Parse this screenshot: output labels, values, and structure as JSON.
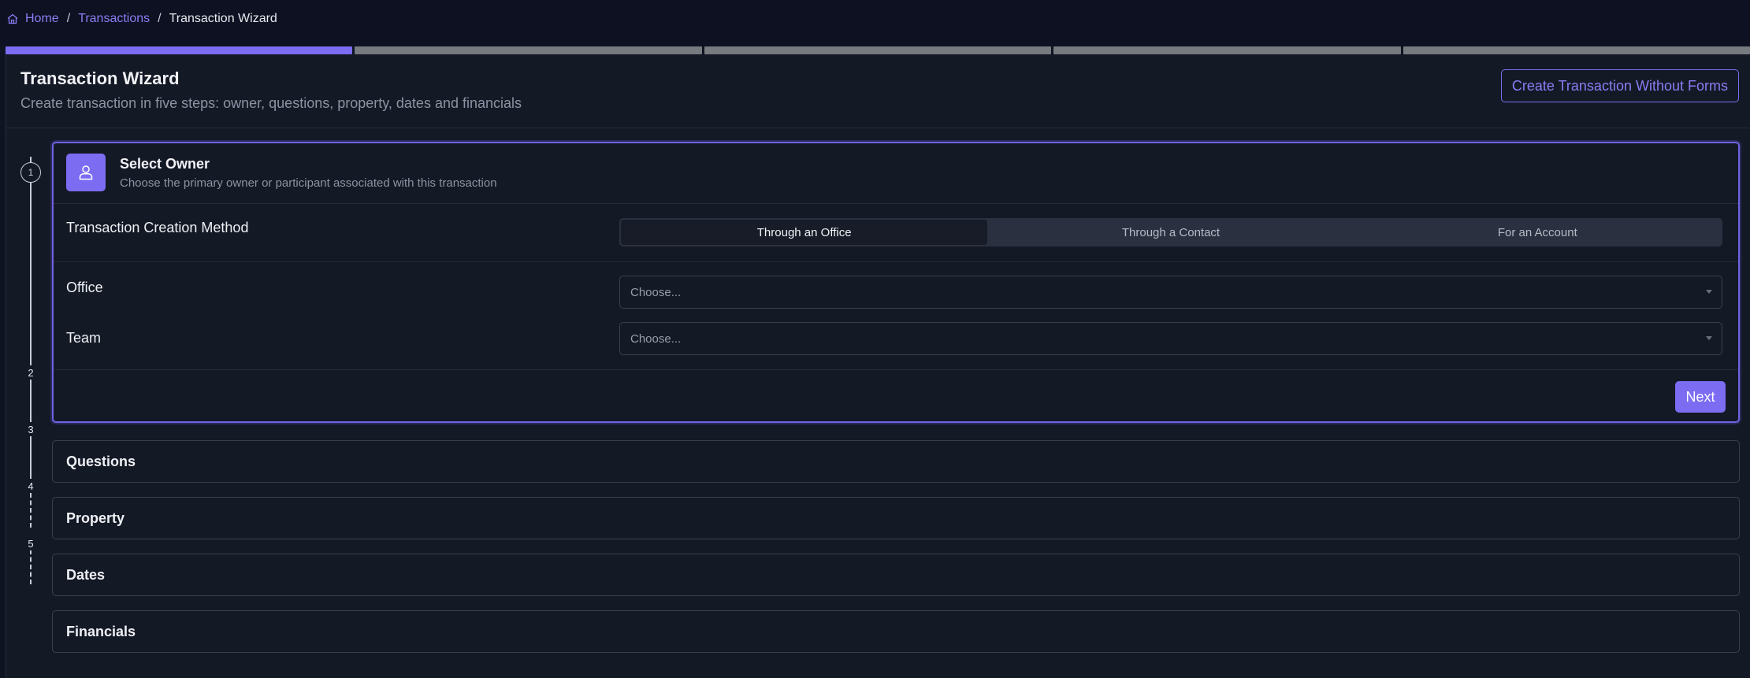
{
  "breadcrumb": {
    "home": "Home",
    "transactions": "Transactions",
    "current": "Transaction Wizard",
    "separator": "/"
  },
  "progress": {
    "total_steps": 5,
    "current_step": 1
  },
  "header": {
    "title": "Transaction Wizard",
    "subtitle": "Create transaction in five steps: owner, questions, property, dates and financials",
    "no_forms_button": "Create Transaction Without Forms"
  },
  "steps": [
    {
      "number": "1",
      "title": "Select Owner"
    },
    {
      "number": "2",
      "title": "Questions"
    },
    {
      "number": "3",
      "title": "Property"
    },
    {
      "number": "4",
      "title": "Dates"
    },
    {
      "number": "5",
      "title": "Financials"
    }
  ],
  "select_owner": {
    "description": "Choose the primary owner or participant associated with this transaction",
    "method_label": "Transaction Creation Method",
    "method_options": [
      "Through an Office",
      "Through a Contact",
      "For an Account"
    ],
    "selected_method": "Through an Office",
    "office_label": "Office",
    "office_placeholder": "Choose...",
    "team_label": "Team",
    "team_placeholder": "Choose...",
    "next_button": "Next"
  },
  "colors": {
    "accent": "#7c6cf2",
    "background": "#0f1422",
    "card": "#141926"
  }
}
